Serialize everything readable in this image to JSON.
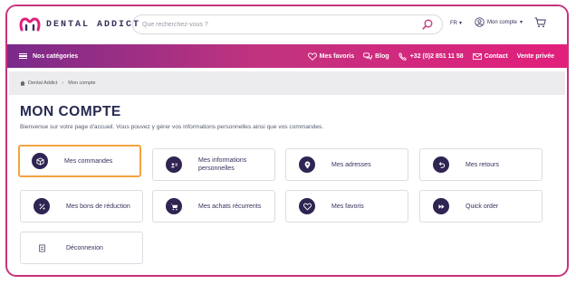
{
  "brand": {
    "name": "DENTAL ADDICT",
    "color": "#3a2f5c",
    "accent": "#e21f7c"
  },
  "search": {
    "placeholder": "Que recherchez-vous ?",
    "icon": "search-icon"
  },
  "header": {
    "language": "FR",
    "account_label": "Mon compte",
    "cart_icon": "cart-icon"
  },
  "nav": {
    "categories_label": "Nos catégories",
    "links": [
      {
        "label": "Mes favoris",
        "icon": "heart-icon"
      },
      {
        "label": "Blog",
        "icon": "chat-icon"
      },
      {
        "label": "+32 (0)2 851 11 58",
        "icon": "phone-icon"
      },
      {
        "label": "Contact",
        "icon": "mail-icon"
      },
      {
        "label": "Vente privée",
        "icon": ""
      }
    ]
  },
  "breadcrumb": {
    "items": [
      "Dental Addict",
      "Mon compte"
    ]
  },
  "page": {
    "title": "MON COMPTE",
    "intro": "Bienvenue sur votre page d'accueil. Vous pouvez y gérer vos informations personnelles ainsi que vos commandes."
  },
  "tiles": [
    {
      "label": "Mes commandes",
      "icon": "box-icon",
      "selected": true
    },
    {
      "label": "Mes informations\npersonnelles",
      "icon": "id-card-icon"
    },
    {
      "label": "Mes adresses",
      "icon": "map-pin-icon"
    },
    {
      "label": "Mes retours",
      "icon": "return-icon"
    },
    {
      "label": "Mes bons de réduction",
      "icon": "percent-icon"
    },
    {
      "label": "Mes achats récurrents",
      "icon": "cart-icon"
    },
    {
      "label": "Mes favoris",
      "icon": "heart-icon"
    },
    {
      "label": "Quick order",
      "icon": "fast-forward-icon"
    },
    {
      "label": "Déconnexion",
      "icon": "logout-icon"
    }
  ]
}
